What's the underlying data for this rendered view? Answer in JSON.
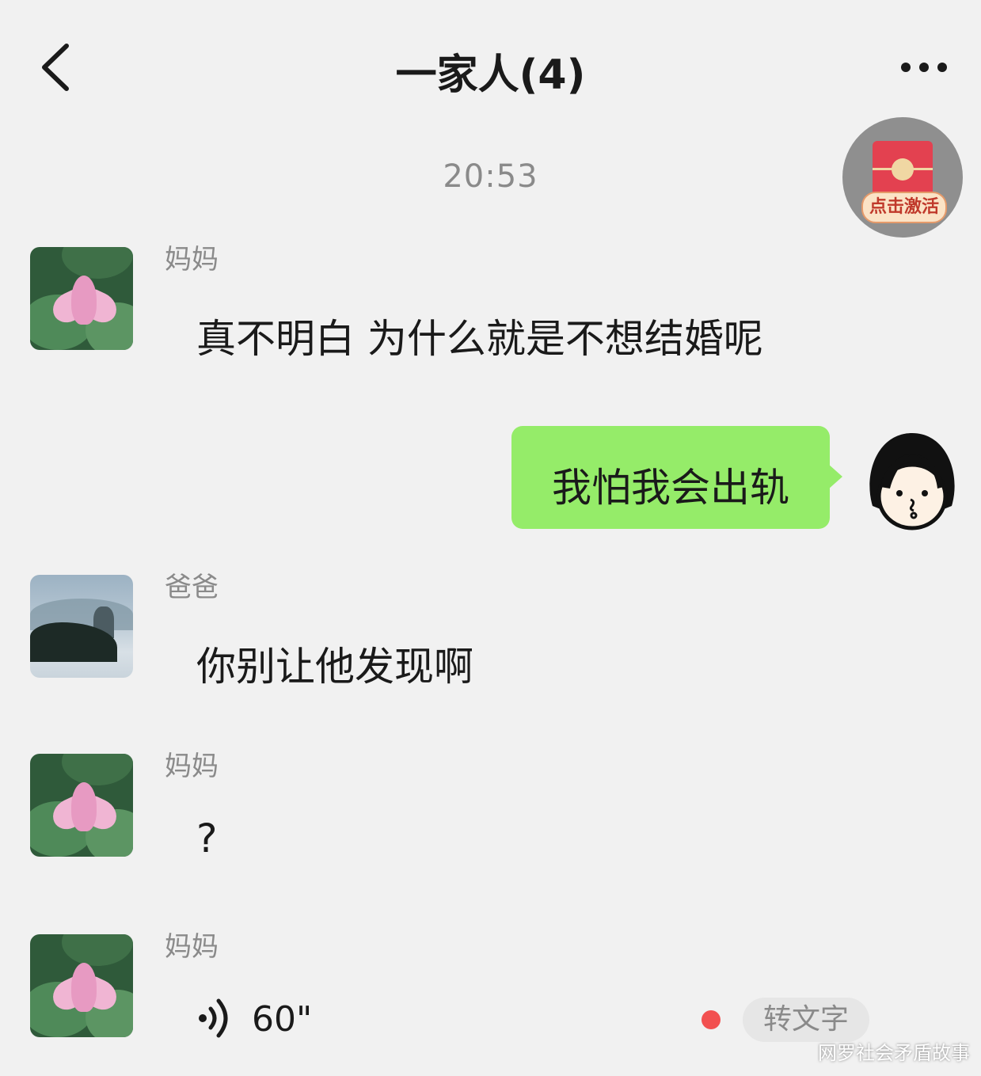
{
  "header": {
    "title": "一家人(4)",
    "back_icon": "chevron-left-icon",
    "more_icon": "ellipsis-icon"
  },
  "timestamp": "20:53",
  "float_widget": {
    "label": "点击激活",
    "icon": "red-packet-icon"
  },
  "messages": [
    {
      "sender": "妈妈",
      "text": "真不明白 为什么就是不想结婚呢"
    },
    {
      "sender": "",
      "text": "我怕我会出轨",
      "self": true
    },
    {
      "sender": "爸爸",
      "text": "你别让他发现啊"
    },
    {
      "sender": "妈妈",
      "text": "?"
    },
    {
      "sender": "妈妈",
      "voice_duration": "60\"",
      "transcribe_label": "转文字"
    }
  ],
  "watermark": "网罗社会矛盾故事",
  "colors": {
    "background": "#f1f1f1",
    "self_bubble": "#95ec69",
    "unread_dot": "#f25050"
  }
}
